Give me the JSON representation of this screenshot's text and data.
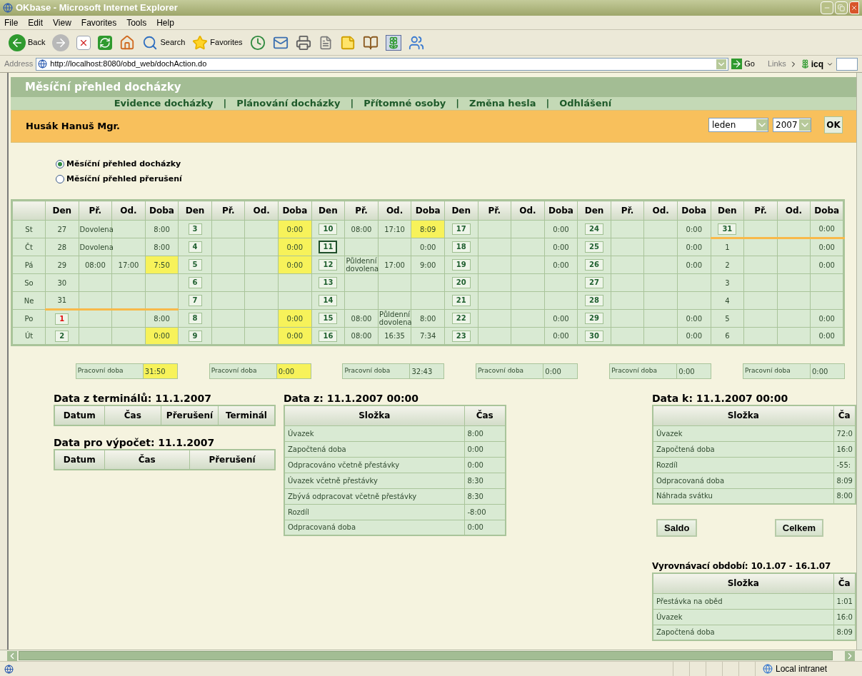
{
  "window": {
    "title": "OKbase - Microsoft Internet Explorer"
  },
  "menu": [
    "File",
    "Edit",
    "View",
    "Favorites",
    "Tools",
    "Help"
  ],
  "toolbar": [
    {
      "kind": "back",
      "label": "Back"
    },
    {
      "kind": "forward"
    },
    {
      "kind": "stop"
    },
    {
      "kind": "refresh"
    },
    {
      "kind": "home"
    },
    {
      "kind": "search",
      "label": "Search"
    },
    {
      "kind": "favorites",
      "label": "Favorites"
    },
    {
      "kind": "history"
    },
    {
      "kind": "mail"
    },
    {
      "kind": "print"
    },
    {
      "kind": "edit"
    },
    {
      "kind": "note"
    },
    {
      "kind": "research"
    },
    {
      "kind": "icq"
    },
    {
      "kind": "messenger"
    }
  ],
  "address": {
    "label": "Address",
    "url": "http://localhost:8080/obd_web/dochAction.do",
    "go": "Go",
    "links": "Links",
    "addon": "icq"
  },
  "page": {
    "title": "Měsíční přehled docházky",
    "nav": [
      {
        "label": "Evidence docházky",
        "separator": "|"
      },
      {
        "label": "Plánování docházky",
        "separator": "|"
      },
      {
        "label": "Přítomné osoby",
        "separator": "|"
      },
      {
        "label": "Změna hesla",
        "separator": "|"
      },
      {
        "label": "Odhlášení"
      }
    ],
    "user": "Husák Hanuš Mgr.",
    "month": "leden",
    "year": "2007",
    "ok": "OK",
    "views": [
      {
        "label": "Měsíční přehled docházky",
        "selected": true
      },
      {
        "label": "Měsíční přehled přerušení",
        "selected": false
      }
    ],
    "calendar": {
      "weekdays": [
        "St",
        "Čt",
        "Pá",
        "So",
        "Ne",
        "Po",
        "Út"
      ],
      "groups": [
        {
          "columns": [
            "Den",
            "Př.",
            "Od.",
            "Doba"
          ],
          "total": {
            "label": "Pracovní doba",
            "value": "31:50",
            "highlighted": true
          },
          "days": [
            {
              "day": "27",
              "kind": "plain",
              "arrival": "Dovolena",
              "duration": "8:00",
              "highlighted": false,
              "month_end": false
            },
            {
              "day": "28",
              "kind": "plain",
              "arrival": "Dovolena",
              "duration": "8:00",
              "highlighted": false,
              "month_end": false
            },
            {
              "day": "29",
              "kind": "plain",
              "arrival": "08:00",
              "departure": "17:00",
              "duration": "7:50",
              "highlighted": true,
              "month_end": false
            },
            {
              "day": "30",
              "kind": "plain",
              "highlighted": false,
              "month_end": false
            },
            {
              "day": "31",
              "kind": "plain",
              "highlighted": false,
              "month_end": true
            },
            {
              "day": "1",
              "kind": "holiday",
              "duration": "8:00",
              "highlighted": false,
              "month_end": false
            },
            {
              "day": "2",
              "kind": "day",
              "duration": "0:00",
              "highlighted": true,
              "month_end": false
            }
          ]
        },
        {
          "columns": [
            "Den",
            "Př.",
            "Od.",
            "Doba"
          ],
          "total": {
            "label": "Pracovní doba",
            "value": "0:00",
            "highlighted": true
          },
          "days": [
            {
              "day": "3",
              "kind": "day",
              "duration": "0:00",
              "highlighted": true,
              "month_end": false
            },
            {
              "day": "4",
              "kind": "day",
              "duration": "0:00",
              "highlighted": true,
              "month_end": false
            },
            {
              "day": "5",
              "kind": "day",
              "duration": "0:00",
              "highlighted": true,
              "month_end": false
            },
            {
              "day": "6",
              "kind": "day",
              "highlighted": false,
              "month_end": false
            },
            {
              "day": "7",
              "kind": "day",
              "highlighted": false,
              "month_end": false
            },
            {
              "day": "8",
              "kind": "day",
              "duration": "0:00",
              "highlighted": true,
              "month_end": false
            },
            {
              "day": "9",
              "kind": "day",
              "duration": "0:00",
              "highlighted": true,
              "month_end": false
            }
          ]
        },
        {
          "columns": [
            "Den",
            "Př.",
            "Od.",
            "Doba"
          ],
          "total": {
            "label": "Pracovní doba",
            "value": "32:43",
            "highlighted": false
          },
          "days": [
            {
              "day": "10",
              "kind": "day",
              "arrival": "08:00",
              "departure": "17:10",
              "duration": "8:09",
              "highlighted": true,
              "month_end": false
            },
            {
              "day": "11",
              "kind": "today",
              "duration": "0:00",
              "highlighted": false,
              "month_end": false
            },
            {
              "day": "12",
              "kind": "day",
              "arrival": "Půldenní dovolena",
              "departure": "17:00",
              "duration": "9:00",
              "highlighted": false,
              "month_end": false
            },
            {
              "day": "13",
              "kind": "day",
              "highlighted": false,
              "month_end": false
            },
            {
              "day": "14",
              "kind": "day",
              "highlighted": false,
              "month_end": false
            },
            {
              "day": "15",
              "kind": "day",
              "arrival": "08:00",
              "departure": "Půldenní dovolena",
              "duration": "8:00",
              "highlighted": false,
              "month_end": false
            },
            {
              "day": "16",
              "kind": "day",
              "arrival": "08:00",
              "departure": "16:35",
              "duration": "7:34",
              "highlighted": false,
              "month_end": false
            }
          ]
        },
        {
          "columns": [
            "Den",
            "Př.",
            "Od.",
            "Doba"
          ],
          "total": {
            "label": "Pracovní doba",
            "value": "0:00",
            "highlighted": false
          },
          "days": [
            {
              "day": "17",
              "kind": "day",
              "duration": "0:00",
              "highlighted": false,
              "month_end": false
            },
            {
              "day": "18",
              "kind": "day",
              "duration": "0:00",
              "highlighted": false,
              "month_end": false
            },
            {
              "day": "19",
              "kind": "day",
              "duration": "0:00",
              "highlighted": false,
              "month_end": false
            },
            {
              "day": "20",
              "kind": "day",
              "highlighted": false,
              "month_end": false
            },
            {
              "day": "21",
              "kind": "day",
              "highlighted": false,
              "month_end": false
            },
            {
              "day": "22",
              "kind": "day",
              "duration": "0:00",
              "highlighted": false,
              "month_end": false
            },
            {
              "day": "23",
              "kind": "day",
              "duration": "0:00",
              "highlighted": false,
              "month_end": false
            }
          ]
        },
        {
          "columns": [
            "Den",
            "Př.",
            "Od.",
            "Doba"
          ],
          "total": {
            "label": "Pracovní doba",
            "value": "0:00",
            "highlighted": false
          },
          "days": [
            {
              "day": "24",
              "kind": "day",
              "duration": "0:00",
              "highlighted": false,
              "month_end": false
            },
            {
              "day": "25",
              "kind": "day",
              "duration": "0:00",
              "highlighted": false,
              "month_end": false
            },
            {
              "day": "26",
              "kind": "day",
              "duration": "0:00",
              "highlighted": false,
              "month_end": false
            },
            {
              "day": "27",
              "kind": "day",
              "highlighted": false,
              "month_end": false
            },
            {
              "day": "28",
              "kind": "day",
              "highlighted": false,
              "month_end": false
            },
            {
              "day": "29",
              "kind": "day",
              "duration": "0:00",
              "highlighted": false,
              "month_end": false
            },
            {
              "day": "30",
              "kind": "day",
              "duration": "0:00",
              "highlighted": false,
              "month_end": false
            }
          ]
        },
        {
          "columns": [
            "Den",
            "Př.",
            "Od.",
            "Doba"
          ],
          "total": {
            "label": "Pracovní doba",
            "value": "0:00",
            "highlighted": false
          },
          "days": [
            {
              "day": "31",
              "kind": "day",
              "duration": "0:00",
              "highlighted": false,
              "month_end": true
            },
            {
              "day": "1",
              "kind": "plain",
              "duration": "0:00",
              "highlighted": false,
              "month_end": false
            },
            {
              "day": "2",
              "kind": "plain",
              "duration": "0:00",
              "highlighted": false,
              "month_end": false
            },
            {
              "day": "3",
              "kind": "plain",
              "highlighted": false,
              "month_end": false
            },
            {
              "day": "4",
              "kind": "plain",
              "highlighted": false,
              "month_end": false
            },
            {
              "day": "5",
              "kind": "plain",
              "duration": "0:00",
              "highlighted": false,
              "month_end": false
            },
            {
              "day": "6",
              "kind": "plain",
              "duration": "0:00",
              "highlighted": false,
              "month_end": false
            }
          ]
        }
      ]
    },
    "terminal_data": {
      "title": "Data z terminálů: 11.1.2007",
      "columns": [
        "Datum",
        "Čas",
        "Přerušení",
        "Terminál"
      ]
    },
    "calc_data": {
      "title": "Data pro výpočet: 11.1.2007",
      "columns": [
        "Datum",
        "Čas",
        "Přerušení"
      ]
    },
    "data_from": {
      "title": "Data z: 11.1.2007 00:00",
      "columns": [
        "Složka",
        "Čas"
      ],
      "rows": [
        [
          "Úvazek",
          "8:00"
        ],
        [
          "Započtená doba",
          "0:00"
        ],
        [
          "Odpracováno včetně přestávky",
          "0:00"
        ],
        [
          "Úvazek včetně přestávky",
          "8:30"
        ],
        [
          "Zbývá odpracovat včetně přestávky",
          "8:30"
        ],
        [
          "Rozdíl",
          "-8:00"
        ],
        [
          "Odpracovaná doba",
          "0:00"
        ]
      ]
    },
    "data_to": {
      "title": "Data k: 11.1.2007 00:00",
      "columns": [
        "Složka",
        "Ča"
      ],
      "rows": [
        [
          "Úvazek",
          "72:0"
        ],
        [
          "Započtená doba",
          "16:0"
        ],
        [
          "Rozdíl",
          "-55:"
        ],
        [
          "Odpracovaná doba",
          "8:09"
        ],
        [
          "Náhrada svátku",
          "8:00"
        ]
      ]
    },
    "buttons": [
      "Saldo",
      "Celkem"
    ],
    "balance": {
      "title": "Vyrovnávací období: 10.1.07 - 16.1.07",
      "columns": [
        "Složka",
        "Ča"
      ],
      "rows": [
        [
          "Přestávka na oběd",
          "1:01"
        ],
        [
          "Úvazek",
          "16:0"
        ],
        [
          "Započtená doba",
          "8:09"
        ]
      ]
    }
  },
  "status_bar": {
    "zone": "Local intranet"
  }
}
